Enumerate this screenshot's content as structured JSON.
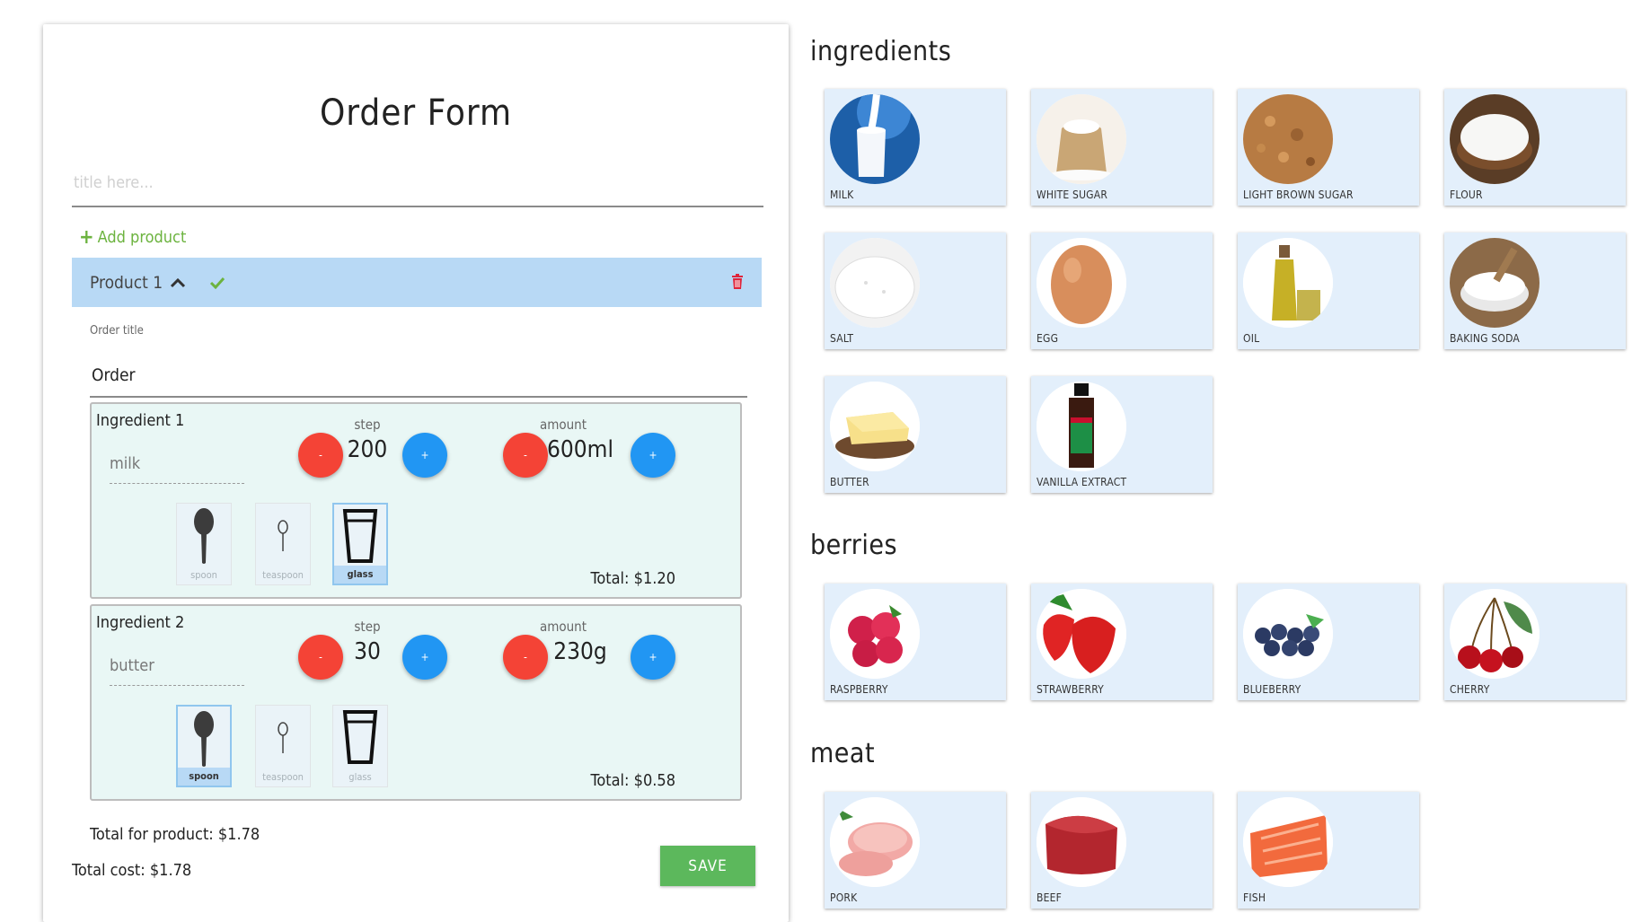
{
  "form": {
    "title": "Order Form",
    "title_placeholder": "title here...",
    "add_product": "Add product",
    "product": {
      "name": "Product 1",
      "order_title_label": "Order title",
      "order_title_value": "Order",
      "ingredients": [
        {
          "label": "Ingredient 1",
          "name": "milk",
          "step_label": "step",
          "step_value": "200",
          "amount_label": "amount",
          "amount_value": "600ml",
          "minus": "-",
          "plus": "+",
          "measures": [
            "spoon",
            "teaspoon",
            "glass"
          ],
          "selected_measure": "glass",
          "total": "Total: $1.20"
        },
        {
          "label": "Ingredient 2",
          "name": "butter",
          "step_label": "step",
          "step_value": "30",
          "amount_label": "amount",
          "amount_value": "230g",
          "minus": "-",
          "plus": "+",
          "measures": [
            "spoon",
            "teaspoon",
            "glass"
          ],
          "selected_measure": "spoon",
          "total": "Total: $0.58"
        }
      ],
      "total": "Total for product: $1.78"
    },
    "total_cost": "Total cost: $1.78",
    "save": "SAVE"
  },
  "catalog": {
    "ingredients": {
      "title": "ingredients",
      "items": [
        "MILK",
        "WHITE SUGAR",
        "LIGHT BROWN SUGAR",
        "FLOUR",
        "SALT",
        "EGG",
        "OIL",
        "BAKING SODA",
        "BUTTER",
        "VANILLA EXTRACT"
      ]
    },
    "berries": {
      "title": "berries",
      "items": [
        "RASPBERRY",
        "STRAWBERRY",
        "BLUEBERRY",
        "CHERRY"
      ]
    },
    "meat": {
      "title": "meat",
      "items": [
        "PORK",
        "BEEF",
        "FISH"
      ]
    }
  },
  "colors": {
    "product_header": "#b8d9f5",
    "ingredient_bg": "#e9f7f5",
    "card_bg": "#e3effb",
    "minus_button": "#f44336",
    "plus_button": "#2196f3",
    "save_button": "#5cb85c",
    "add_product": "#6cb33f"
  }
}
